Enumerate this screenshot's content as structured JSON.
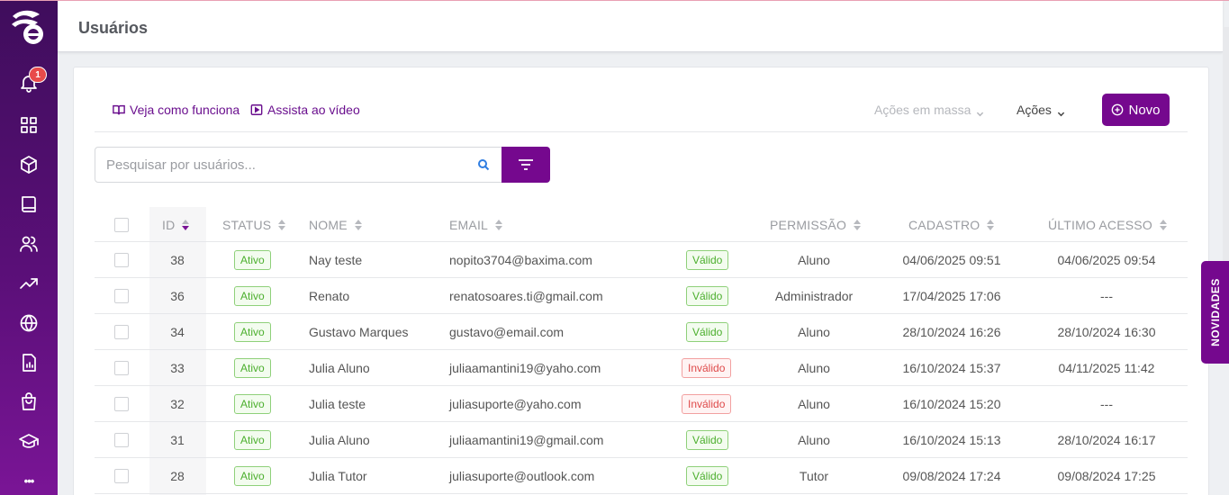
{
  "header": {
    "title": "Usuários"
  },
  "sidebar": {
    "notification_count": "1",
    "more_label": "•••"
  },
  "toolbar": {
    "how_it_works": "Veja como funciona",
    "watch_video": "Assista ao vídeo",
    "bulk_actions": "Ações em massa",
    "actions": "Ações",
    "new_button": "Novo"
  },
  "search": {
    "placeholder": "Pesquisar por usuários..."
  },
  "table": {
    "headers": {
      "id": "ID",
      "status": "STATUS",
      "name": "NOME",
      "email": "EMAIL",
      "permission": "PERMISSÃO",
      "created": "CADASTRO",
      "last_access": "ÚLTIMO ACESSO"
    },
    "rows": [
      {
        "id": "38",
        "status": "Ativo",
        "name": "Nay teste",
        "email": "nopito3704@baxima.com",
        "validity": "Válido",
        "valid": true,
        "permission": "Aluno",
        "created": "04/06/2025 09:51",
        "last_access": "04/06/2025 09:54"
      },
      {
        "id": "36",
        "status": "Ativo",
        "name": "Renato",
        "email": "renatosoares.ti@gmail.com",
        "validity": "Válido",
        "valid": true,
        "permission": "Administrador",
        "created": "17/04/2025 17:06",
        "last_access": "---"
      },
      {
        "id": "34",
        "status": "Ativo",
        "name": "Gustavo Marques",
        "email": "gustavo@email.com",
        "validity": "Válido",
        "valid": true,
        "permission": "Aluno",
        "created": "28/10/2024 16:26",
        "last_access": "28/10/2024 16:30"
      },
      {
        "id": "33",
        "status": "Ativo",
        "name": "Julia Aluno",
        "email": "juliaamantini19@yaho.com",
        "validity": "Inválido",
        "valid": false,
        "permission": "Aluno",
        "created": "16/10/2024 15:37",
        "last_access": "04/11/2025 11:42"
      },
      {
        "id": "32",
        "status": "Ativo",
        "name": "Julia teste",
        "email": "juliasuporte@yaho.com",
        "validity": "Inválido",
        "valid": false,
        "permission": "Aluno",
        "created": "16/10/2024 15:20",
        "last_access": "---"
      },
      {
        "id": "31",
        "status": "Ativo",
        "name": "Julia Aluno",
        "email": "juliaamantini19@gmail.com",
        "validity": "Válido",
        "valid": true,
        "permission": "Aluno",
        "created": "16/10/2024 15:13",
        "last_access": "28/10/2024 16:17"
      },
      {
        "id": "28",
        "status": "Ativo",
        "name": "Julia Tutor",
        "email": "juliasuporte@outlook.com",
        "validity": "Válido",
        "valid": true,
        "permission": "Tutor",
        "created": "09/08/2024 17:24",
        "last_access": "09/08/2024 17:25"
      }
    ]
  },
  "side_tab": {
    "label": "NOVIDADES"
  },
  "colors": {
    "brand": "#75088e",
    "valid": "#4caf2e",
    "invalid": "#de4a4a"
  }
}
